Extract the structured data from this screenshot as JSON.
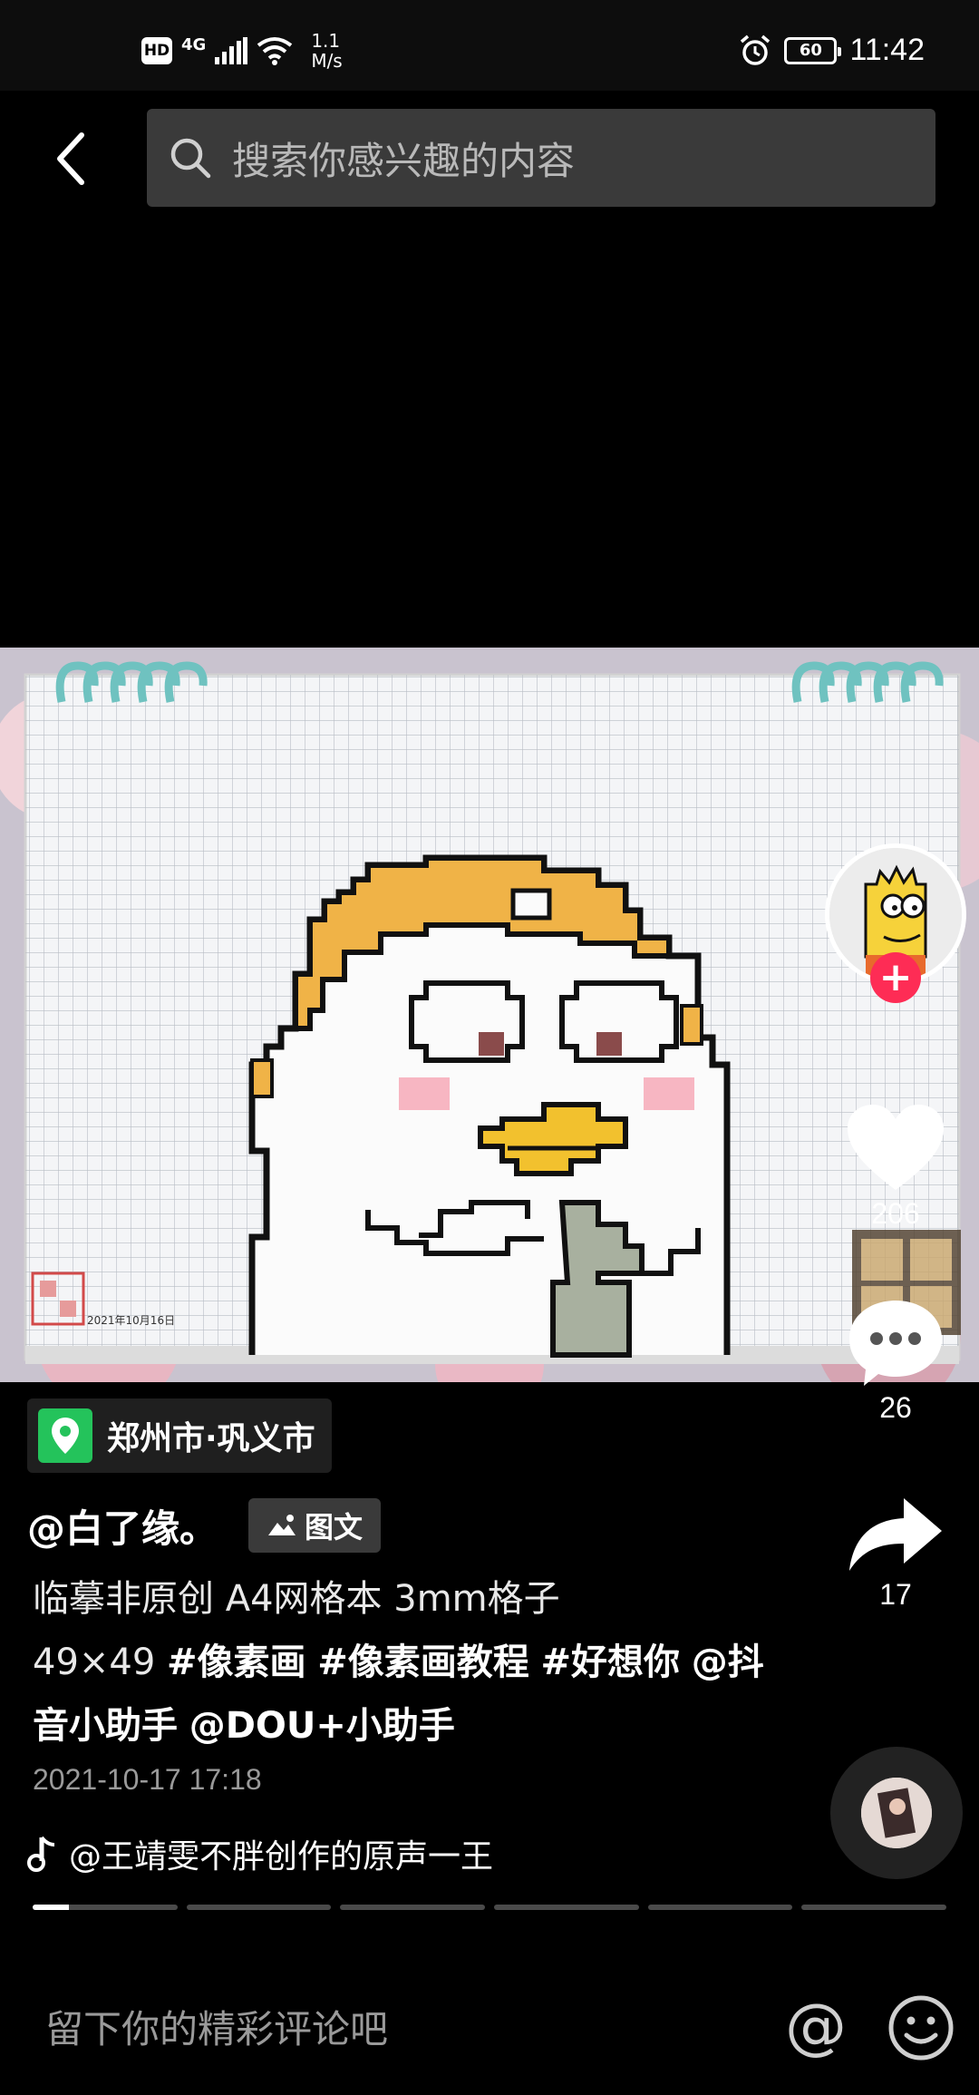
{
  "status_bar": {
    "hd": "HD",
    "network": "4G",
    "speed_value": "1.1",
    "speed_unit": "M/s",
    "battery": "60",
    "time": "11:42"
  },
  "search": {
    "placeholder": "搜索你感兴趣的内容"
  },
  "post": {
    "image_stamp_date": "2021年10月16日",
    "location": "郑州市·巩义市",
    "author": "@白了缘。",
    "type_badge": "图文",
    "caption_line1": "临摹非原创 A4网格本 3mm格子",
    "caption_prefix": "49×49 ",
    "tag1": "#像素画",
    "tag2": "#像素画教程",
    "tag3": "#好想你",
    "mention1": "@抖音小助手",
    "mention2": "@DOU+小助手",
    "time": "2021-10-17 17:18",
    "music": "@王靖雯不胖创作的原声一王"
  },
  "actions": {
    "follow_symbol": "+",
    "likes": "206",
    "comments": "26",
    "shares": "17"
  },
  "progress": {
    "segments": 6,
    "current_segment": 0,
    "current_fraction": 0.25
  },
  "comment_bar": {
    "placeholder": "留下你的精彩评论吧",
    "at_symbol": "@"
  },
  "colors": {
    "follow": "#fe2c55",
    "location_icon": "#24c35b",
    "hat": "#f0b347",
    "beak": "#f2c12e",
    "blush": "#f7b6c2"
  }
}
